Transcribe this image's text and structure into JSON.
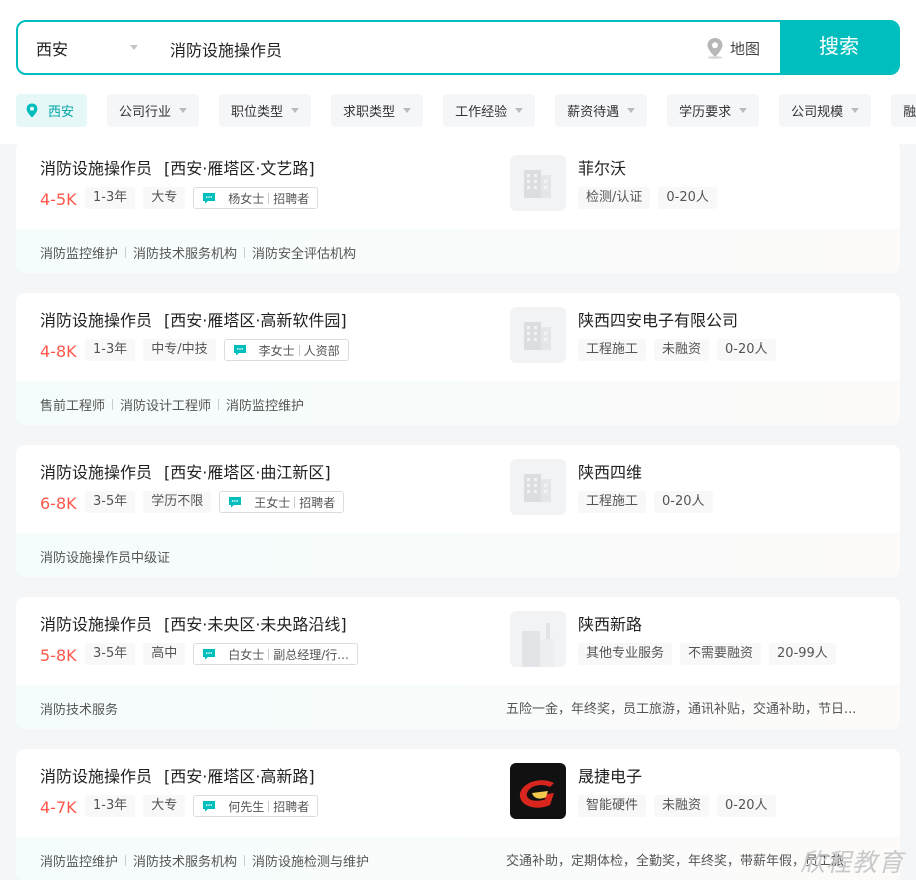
{
  "search": {
    "city": "西安",
    "query": "消防设施操作员",
    "map_label": "地图",
    "button_label": "搜索"
  },
  "filters": [
    {
      "label": "西安",
      "active": true
    },
    {
      "label": "公司行业"
    },
    {
      "label": "职位类型"
    },
    {
      "label": "求职类型"
    },
    {
      "label": "工作经验"
    },
    {
      "label": "薪资待遇"
    },
    {
      "label": "学历要求"
    },
    {
      "label": "公司规模"
    },
    {
      "label": "融"
    }
  ],
  "jobs": [
    {
      "title": "消防设施操作员",
      "area": "[西安·雁塔区·文艺路]",
      "salary": "4-5K",
      "experience": "1-3年",
      "degree": "大专",
      "recruiter_name": "杨女士",
      "recruiter_role": "招聘者",
      "company": "菲尔沃",
      "company_tags": [
        "检测/认证",
        "0-20人"
      ],
      "skills": [
        "消防监控维护",
        "消防技术服务机构",
        "消防安全评估机构"
      ],
      "welfare": ""
    },
    {
      "title": "消防设施操作员",
      "area": "[西安·雁塔区·高新软件园]",
      "salary": "4-8K",
      "experience": "1-3年",
      "degree": "中专/中技",
      "recruiter_name": "李女士",
      "recruiter_role": "人资部",
      "company": "陕西四安电子有限公司",
      "company_tags": [
        "工程施工",
        "未融资",
        "0-20人"
      ],
      "skills": [
        "售前工程师",
        "消防设计工程师",
        "消防监控维护"
      ],
      "welfare": ""
    },
    {
      "title": "消防设施操作员",
      "area": "[西安·雁塔区·曲江新区]",
      "salary": "6-8K",
      "experience": "3-5年",
      "degree": "学历不限",
      "recruiter_name": "王女士",
      "recruiter_role": "招聘者",
      "company": "陕西四维",
      "company_tags": [
        "工程施工",
        "0-20人"
      ],
      "skills": [
        "消防设施操作员中级证"
      ],
      "welfare": ""
    },
    {
      "title": "消防设施操作员",
      "area": "[西安·未央区·未央路沿线]",
      "salary": "5-8K",
      "experience": "3-5年",
      "degree": "高中",
      "recruiter_name": "白女士",
      "recruiter_role": "副总经理/行...",
      "company": "陕西新路",
      "company_tags": [
        "其他专业服务",
        "不需要融资",
        "20-99人"
      ],
      "skills": [
        "消防技术服务"
      ],
      "welfare": "五险一金，年终奖，员工旅游，通讯补贴，交通补助，节日..."
    },
    {
      "title": "消防设施操作员",
      "area": "[西安·雁塔区·高新路]",
      "salary": "4-7K",
      "experience": "1-3年",
      "degree": "大专",
      "recruiter_name": "何先生",
      "recruiter_role": "招聘者",
      "company": "晟捷电子",
      "company_tags": [
        "智能硬件",
        "未融资",
        "0-20人"
      ],
      "skills": [
        "消防监控维护",
        "消防技术服务机构",
        "消防设施检测与维护"
      ],
      "welfare": "交通补助，定期体检，全勤奖，年终奖，带薪年假，员工旅"
    }
  ],
  "watermark": "欣程教育",
  "colors": {
    "accent": "#00bebd",
    "salary": "#fe574a"
  }
}
